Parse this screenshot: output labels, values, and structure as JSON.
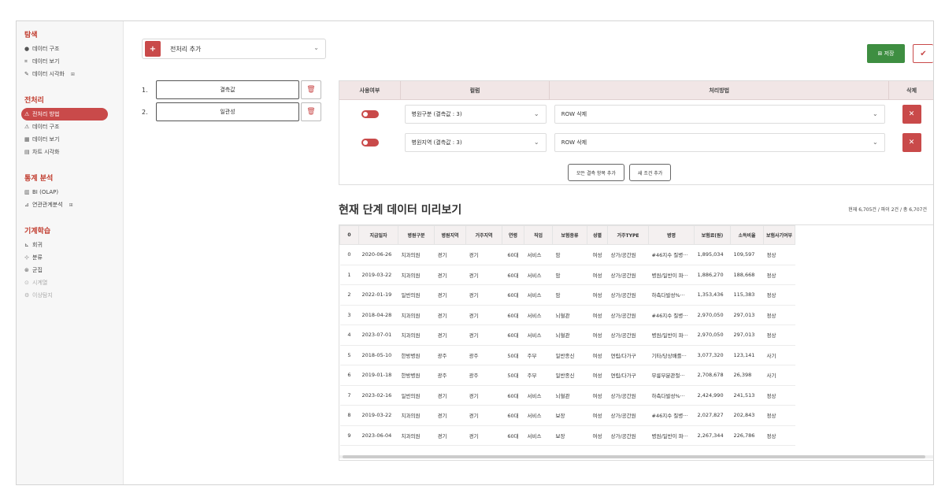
{
  "sidebar": {
    "sections": [
      {
        "title": "탐색",
        "items": [
          {
            "icon": "●",
            "label": "데이터 구조",
            "badge": ""
          },
          {
            "icon": "⌗",
            "label": "데이터 보기",
            "badge": ""
          },
          {
            "icon": "✎",
            "label": "데이터 시각화",
            "badge": "⊞"
          }
        ]
      },
      {
        "title": "전처리",
        "items": [
          {
            "icon": "⚠",
            "label": "전처리 방법",
            "badge": "",
            "active": true
          },
          {
            "icon": "⚠",
            "label": "데이터 구조",
            "badge": ""
          },
          {
            "icon": "▦",
            "label": "데이터 보기",
            "badge": ""
          },
          {
            "icon": "▤",
            "label": "차트 시각화",
            "badge": ""
          }
        ]
      },
      {
        "title": "통계 분석",
        "items": [
          {
            "icon": "▥",
            "label": "BI (OLAP)",
            "badge": ""
          },
          {
            "icon": "⊿",
            "label": "연관관계분석",
            "badge": "⊞"
          }
        ]
      },
      {
        "title": "기계학습",
        "items": [
          {
            "icon": "⊾",
            "label": "회귀",
            "badge": ""
          },
          {
            "icon": "⊹",
            "label": "분류",
            "badge": ""
          },
          {
            "icon": "⊛",
            "label": "군집",
            "badge": ""
          },
          {
            "icon": "⊙",
            "label": "시계열",
            "badge": "",
            "disabled": true
          },
          {
            "icon": "⚙",
            "label": "이상탐지",
            "badge": "",
            "disabled": true
          }
        ]
      }
    ]
  },
  "toolbar": {
    "add_label": "+",
    "preprocess_label": "전처리 추가",
    "save_label": "⊞ 저장",
    "check_label": "✔"
  },
  "steps": [
    {
      "num": "1.",
      "label": "결측값",
      "del": "🗑"
    },
    {
      "num": "2.",
      "label": "일관성",
      "del": "🗑"
    }
  ],
  "conditions": {
    "headers": [
      "사용여부",
      "컬럼",
      "처리방법",
      "삭제"
    ],
    "rows": [
      {
        "column": "병원구분 (결측값 : 3)",
        "method": "ROW 삭제",
        "del": "✕"
      },
      {
        "column": "병원지역 (결측값 : 3)",
        "method": "ROW 삭제",
        "del": "✕"
      }
    ],
    "buttons": [
      "모든 결측 항목 추가",
      "새 조건 추가"
    ]
  },
  "preview": {
    "title": "현재 단계 데이터 미리보기",
    "info": "현재 6,705건 / 파이 2건 / 총 6,707건",
    "columns": [
      "0",
      "지급일자",
      "병원구분",
      "병원지역",
      "거주지역",
      "연령",
      "직업",
      "보험종류",
      "성별",
      "거주TYPE",
      "병명",
      "보험료(원)",
      "소득비율",
      "보험사기여부"
    ],
    "rows": [
      [
        "0",
        "2020-06-26",
        "치과의원",
        "경기",
        "경기",
        "60대",
        "서비스",
        "암",
        "여성",
        "상가/공간원",
        "#46지수 질병···",
        "1,895,034",
        "109,597",
        "정상"
      ],
      [
        "1",
        "2019-03-22",
        "치과의원",
        "경기",
        "경기",
        "60대",
        "서비스",
        "암",
        "여성",
        "상가/공간원",
        "병원/일반이 파···",
        "1,886,270",
        "188,668",
        "정상"
      ],
      [
        "2",
        "2022-01-19",
        "일반의원",
        "경기",
        "경기",
        "60대",
        "서비스",
        "암",
        "여성",
        "상가/공간원",
        "하측다발성%···",
        "1,353,436",
        "115,383",
        "정상"
      ],
      [
        "3",
        "2018-04-28",
        "치과의원",
        "경기",
        "경기",
        "60대",
        "서비스",
        "뇌혈관",
        "여성",
        "상가/공간원",
        "#46지수 질병···",
        "2,970,050",
        "297,013",
        "정상"
      ],
      [
        "4",
        "2023-07-01",
        "치과의원",
        "경기",
        "경기",
        "60대",
        "서비스",
        "뇌혈관",
        "여성",
        "상가/공간원",
        "병원/일반이 파···",
        "2,970,050",
        "297,013",
        "정상"
      ],
      [
        "5",
        "2018-05-10",
        "한방병원",
        "광주",
        "광주",
        "50대",
        "주부",
        "일반종신",
        "여성",
        "연립/다가구",
        "기타/당상배를···",
        "3,077,320",
        "123,141",
        "사기"
      ],
      [
        "6",
        "2019-01-18",
        "한방병원",
        "광주",
        "광주",
        "50대",
        "주부",
        "일반종신",
        "여성",
        "연립/다가구",
        "무릎부분관절···",
        "2,708,678",
        "26,398",
        "사기"
      ],
      [
        "7",
        "2023-02-16",
        "일반의원",
        "경기",
        "경기",
        "60대",
        "서비스",
        "뇌혈관",
        "여성",
        "상가/공간원",
        "하측다발성%···",
        "2,424,990",
        "241,513",
        "정상"
      ],
      [
        "8",
        "2019-03-22",
        "치과의원",
        "경기",
        "경기",
        "60대",
        "서비스",
        "보장",
        "여성",
        "상가/공간원",
        "#46지수 질병···",
        "2,027,827",
        "202,843",
        "정상"
      ],
      [
        "9",
        "2023-06-04",
        "치과의원",
        "경기",
        "경기",
        "60대",
        "서비스",
        "보장",
        "여성",
        "상가/공간원",
        "병원/일반이 파···",
        "2,267,344",
        "226,786",
        "정상"
      ]
    ]
  },
  "colors": {
    "accent": "#c94a4a",
    "save": "#3e8e41"
  }
}
